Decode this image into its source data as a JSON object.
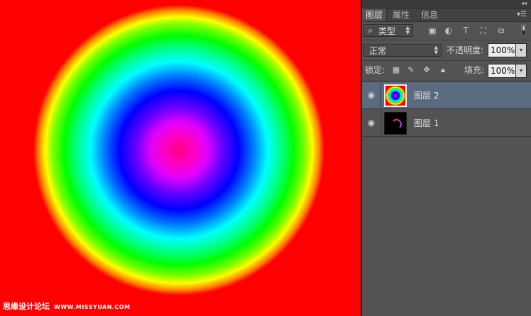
{
  "panel": {
    "collapse_icon": "double-chevron-left-icon",
    "tabs": [
      {
        "label": "图层",
        "active": true
      },
      {
        "label": "属性",
        "active": false
      },
      {
        "label": "信息",
        "active": false
      }
    ],
    "menu_icon": "panel-menu-icon",
    "filter": {
      "icon": "search-icon",
      "selected": "类型"
    },
    "filter_icons": [
      "image-filter-icon",
      "adjustment-filter-icon",
      "text-filter-icon",
      "shape-filter-icon",
      "smart-object-filter-icon"
    ],
    "blend_mode": {
      "selected": "正常"
    },
    "opacity": {
      "label": "不透明度:",
      "value": "100%"
    },
    "lock": {
      "label": "锁定:",
      "icons": [
        "lock-transparent-icon",
        "lock-paint-icon",
        "lock-move-icon",
        "lock-all-icon"
      ]
    },
    "fill": {
      "label": "填充:",
      "value": "100%"
    },
    "layers": [
      {
        "name": "图层 2",
        "selected": true,
        "visible": true
      },
      {
        "name": "图层 1",
        "selected": false,
        "visible": true
      }
    ]
  },
  "watermark": {
    "text": "思缘设计论坛",
    "url": "WWW.MISSYUAN.COM"
  },
  "colors": {
    "canvas_background": "#ff0000",
    "selected_layer": "#5a6b80",
    "panel_bg": "#535353"
  }
}
